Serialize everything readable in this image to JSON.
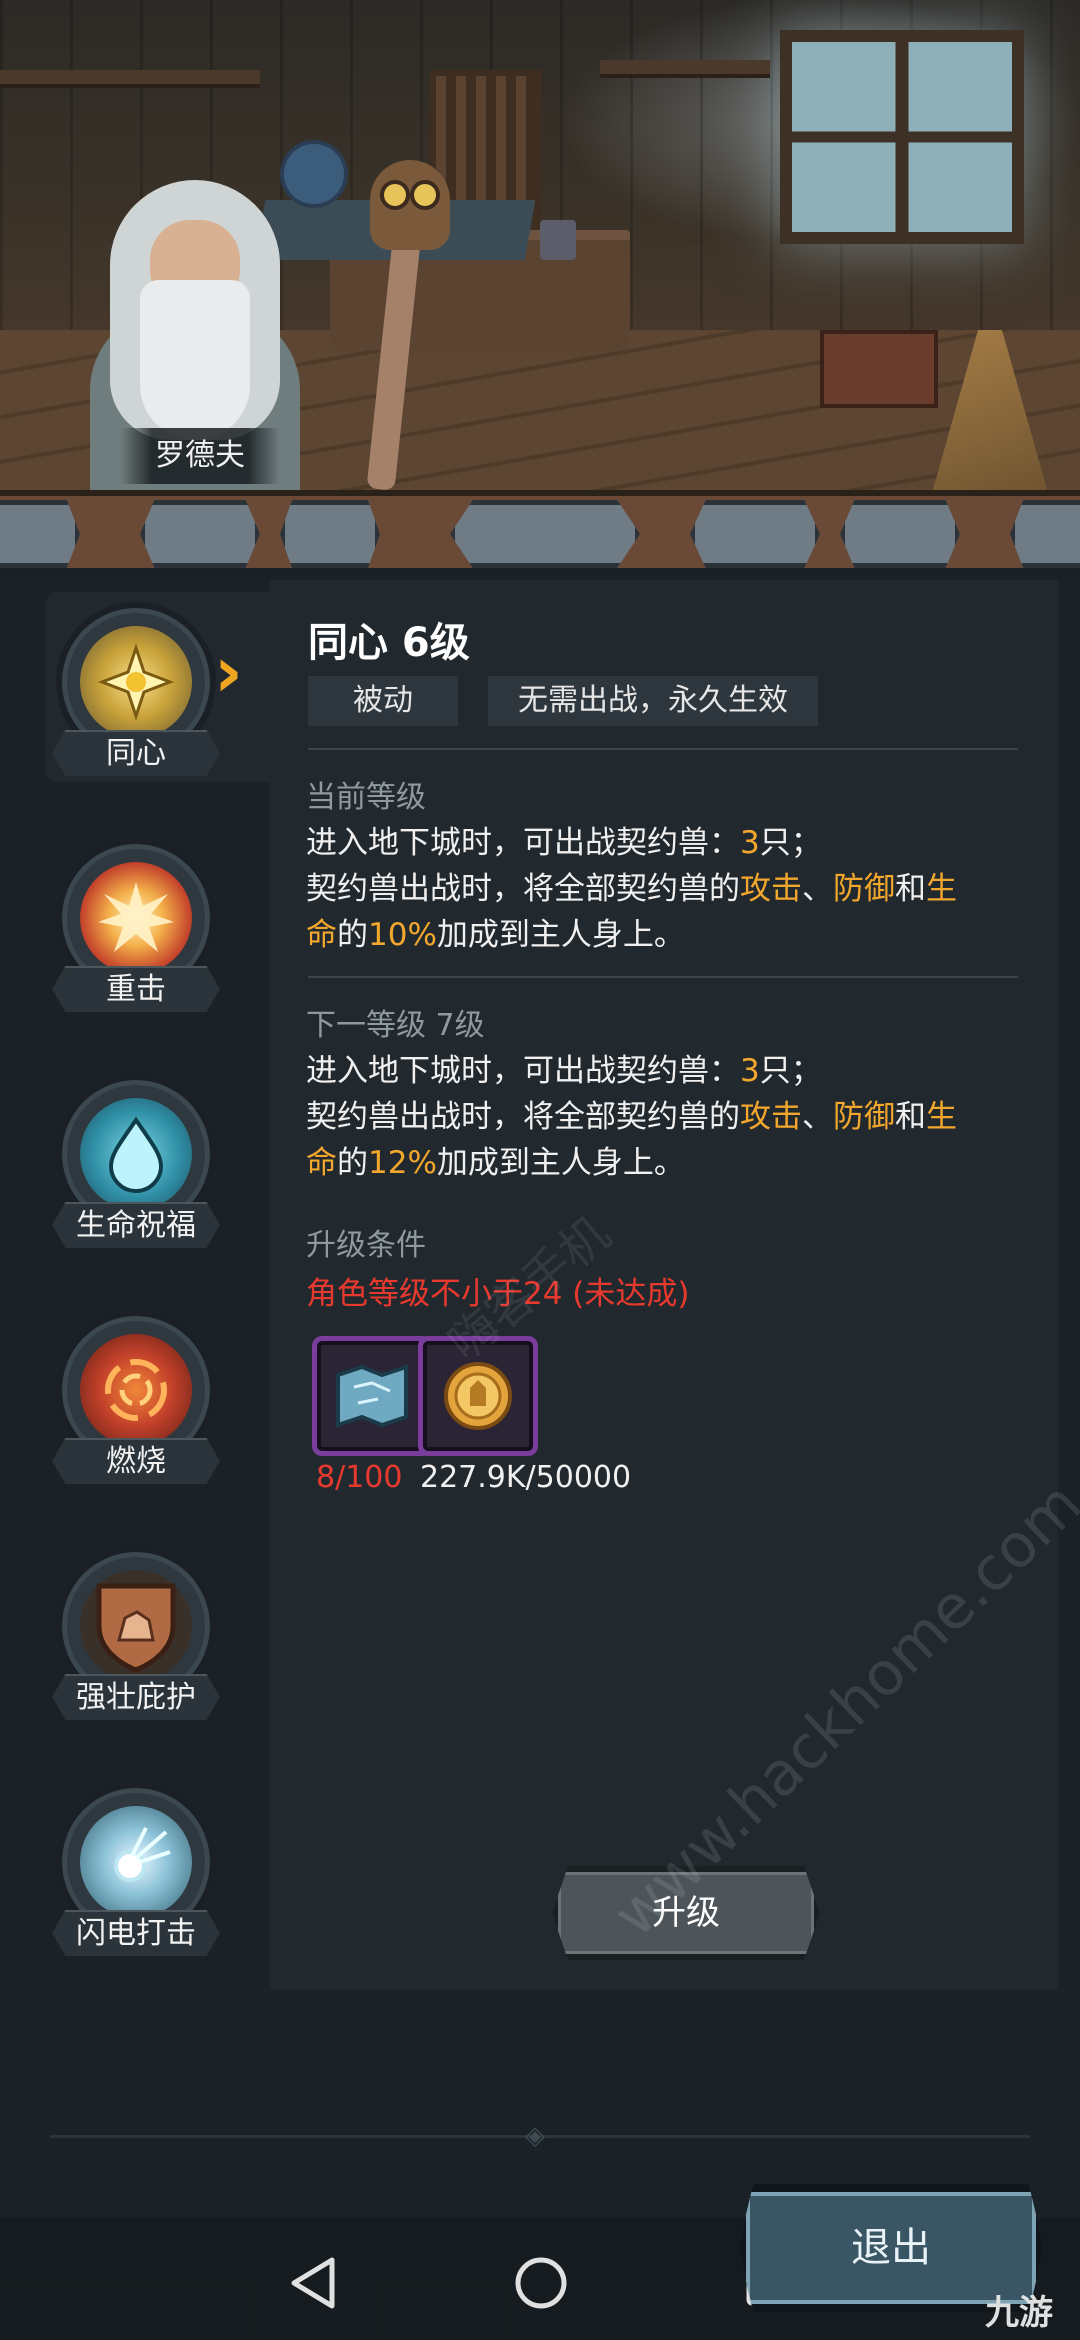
{
  "scene": {
    "npc_name": "罗德夫"
  },
  "sidebar": {
    "items": [
      {
        "label": "同心",
        "icon": "sun-star-icon",
        "active": true
      },
      {
        "label": "重击",
        "icon": "burst-explosion-icon",
        "active": false
      },
      {
        "label": "生命祝福",
        "icon": "water-drop-icon",
        "active": false
      },
      {
        "label": "燃烧",
        "icon": "fire-swirl-icon",
        "active": false
      },
      {
        "label": "强壮庇护",
        "icon": "rock-shield-icon",
        "active": false
      },
      {
        "label": "闪电打击",
        "icon": "lightning-orb-icon",
        "active": false
      }
    ]
  },
  "detail": {
    "title": "同心 6级",
    "tag_type": "被动",
    "tag_effect": "无需出战，永久生效",
    "current": {
      "heading": "当前等级",
      "line1_pre": "进入地下城时，可出战契约兽：",
      "line1_num": "3",
      "line1_post": "只；",
      "line2_pre": "契约兽出战时，将全部契约兽的",
      "attack": "攻击",
      "sep": "、",
      "defense": "防御",
      "and": "和",
      "hp_a": "生",
      "hp_b": "命",
      "de": "的",
      "percent": "10%",
      "line2_post": "加成到主人身上。"
    },
    "next": {
      "heading": "下一等级 7级",
      "line1_pre": "进入地下城时，可出战契约兽：",
      "line1_num": "3",
      "line1_post": "只；",
      "line2_pre": "契约兽出战时，将全部契约兽的",
      "attack": "攻击",
      "sep": "、",
      "defense": "防御",
      "and": "和",
      "hp_a": "生",
      "hp_b": "命",
      "de": "的",
      "percent": "12%",
      "line2_post": "加成到主人身上。"
    },
    "requirement": {
      "heading": "升级条件",
      "text": "角色等级不小于24 (未达成)"
    },
    "materials": [
      {
        "icon": "scroll-map-icon",
        "count": "8/100",
        "count_color": "#e8392f"
      },
      {
        "icon": "gold-coin-icon",
        "count": "227.9K/50000",
        "count_color": "#f0f0f0"
      }
    ],
    "upgrade_label": "升级"
  },
  "exit_label": "退出",
  "watermark": "www.hackhome.com",
  "watermark2": "嗨客手机",
  "corner_logo": "九游",
  "colors": {
    "highlight": "#f3a72d",
    "warning": "#e8392f",
    "panel_bg": "#22292e",
    "page_bg": "#1b2227"
  }
}
